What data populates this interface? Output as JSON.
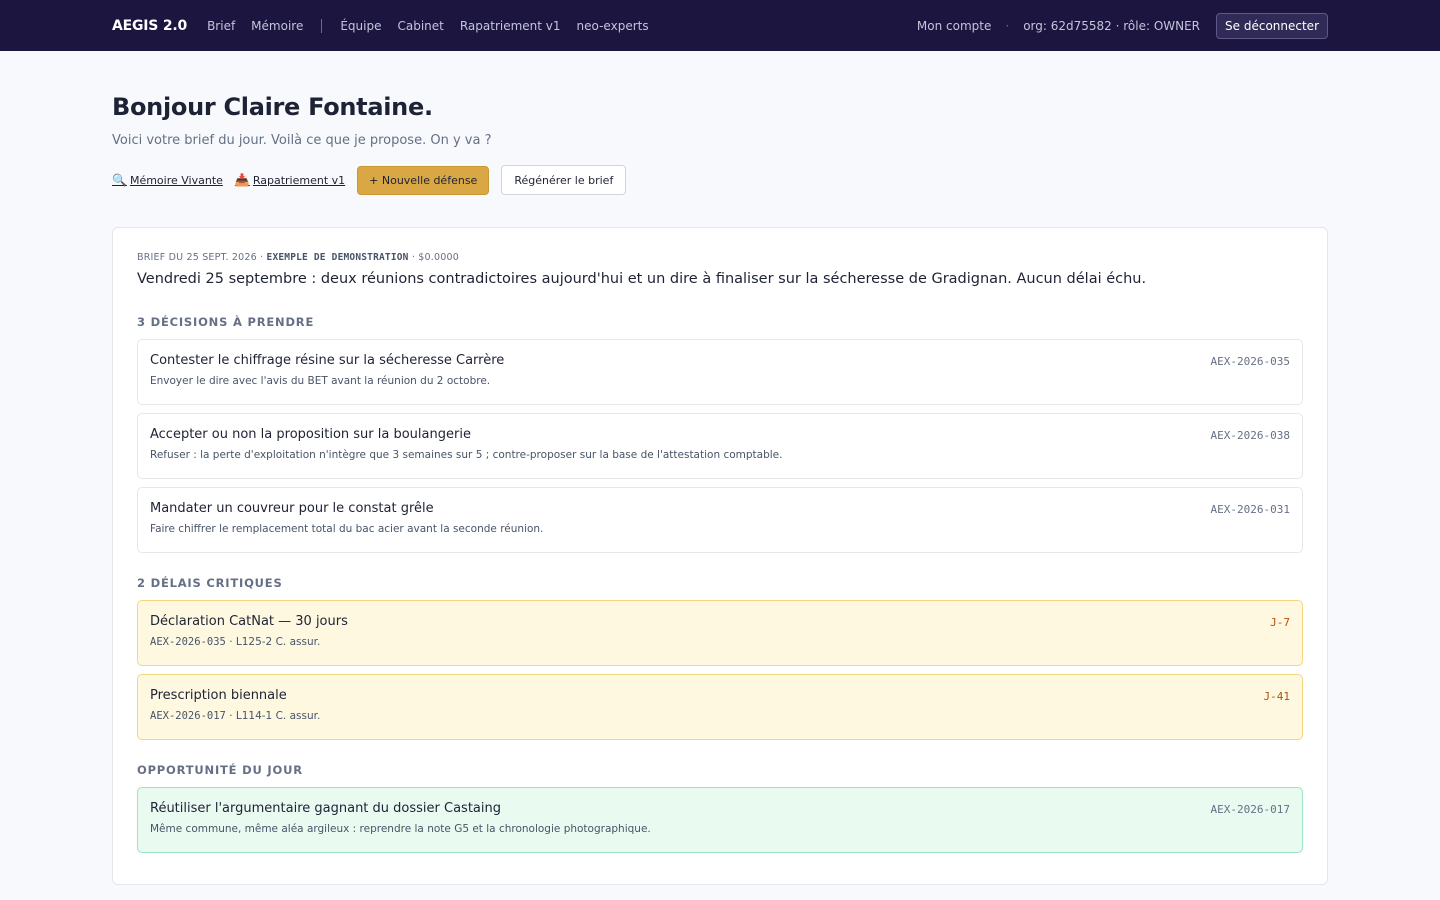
{
  "topbar": {
    "brand": "AEGIS 2.0",
    "nav": [
      "Brief",
      "Mémoire",
      "Équipe",
      "Cabinet",
      "Rapatriement v1",
      "neo-experts"
    ],
    "account": "Mon compte",
    "separator": "·",
    "org": "org: 62d75582 · rôle: OWNER",
    "logout": "Se déconnecter"
  },
  "header": {
    "greeting": "Bonjour Claire Fontaine.",
    "subtitle": "Voici votre brief du jour. Voilà ce que je propose. On y va ?"
  },
  "actions": {
    "memoire_icon": "🔍",
    "memoire_label": "Mémoire Vivante",
    "rapatriement_icon": "📥",
    "rapatriement_label": "Rapatriement v1",
    "new_defense": "+ Nouvelle défense",
    "regenerate": "Régénérer le brief"
  },
  "brief": {
    "meta_prefix": "BRIEF DU 25 SEPT. 2026 ·",
    "meta_demo": "EXEMPLE DE DEMONSTRATION",
    "meta_cost": "· $0.0000",
    "summary": "Vendredi 25 septembre : deux réunions contradictoires aujourd'hui et un dire à finaliser sur la sécheresse de Gradignan. Aucun délai échu.",
    "decisions_title": "3 DÉCISIONS À PRENDRE",
    "decisions": [
      {
        "title": "Contester le chiffrage résine sur la sécheresse Carrère",
        "sub": "Envoyer le dire avec l'avis du BET avant la réunion du 2 octobre.",
        "ref": "AEX-2026-035"
      },
      {
        "title": "Accepter ou non la proposition sur la boulangerie",
        "sub": "Refuser : la perte d'exploitation n'intègre que 3 semaines sur 5 ; contre-proposer sur la base de l'attestation comptable.",
        "ref": "AEX-2026-038"
      },
      {
        "title": "Mandater un couvreur pour le constat grêle",
        "sub": "Faire chiffrer le remplacement total du bac acier avant la seconde réunion.",
        "ref": "AEX-2026-031"
      }
    ],
    "deadlines_title": "2 DÉLAIS CRITIQUES",
    "deadlines": [
      {
        "title": "Déclaration CatNat — 30 jours",
        "code": "AEX-2026-035",
        "sub": "· L125-2 C. assur.",
        "ref": "J-7"
      },
      {
        "title": "Prescription biennale",
        "code": "AEX-2026-017",
        "sub": "· L114-1 C. assur.",
        "ref": "J-41"
      }
    ],
    "opportunity_title": "OPPORTUNITÉ DU JOUR",
    "opportunity": {
      "title": "Réutiliser l'argumentaire gagnant du dossier Castaing",
      "sub": "Même commune, même aléa argileux : reprendre la note G5 et la chronologie photographique.",
      "ref": "AEX-2026-017"
    }
  }
}
